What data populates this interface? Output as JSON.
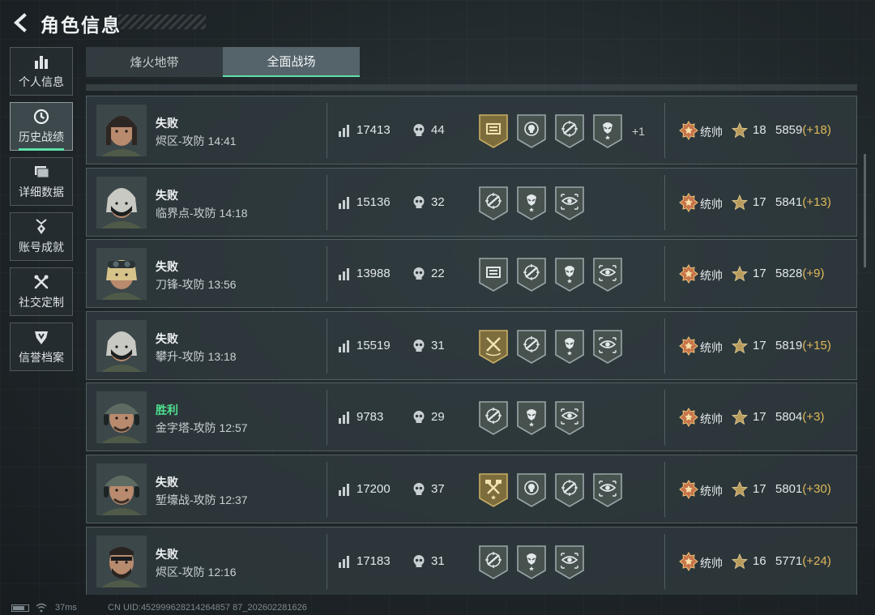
{
  "header": {
    "title": "角色信息"
  },
  "sidebar": {
    "items": [
      {
        "label": "个人信息",
        "icon": "bar-chart-icon",
        "active": false
      },
      {
        "label": "历史战绩",
        "icon": "clock-icon",
        "active": true
      },
      {
        "label": "详细数据",
        "icon": "folder-icon",
        "active": false
      },
      {
        "label": "账号成就",
        "icon": "medal-icon",
        "active": false
      },
      {
        "label": "社交定制",
        "icon": "tools-icon",
        "active": false
      },
      {
        "label": "信誉档案",
        "icon": "shield-icon",
        "active": false
      }
    ]
  },
  "tabs": [
    {
      "label": "烽火地带",
      "active": false
    },
    {
      "label": "全面战场",
      "active": true
    }
  ],
  "colors": {
    "accent": "#5fe0a8",
    "win": "#4ee08e",
    "delta": "#e0b85a",
    "gold_badge": "#8a7a45",
    "silver_badge": "#4a5558"
  },
  "matches": [
    {
      "result": "失败",
      "win": false,
      "map_time": "烬区-攻防 14:41",
      "score": "17413",
      "kills": "44",
      "badges": [
        "gold-screen-badge",
        "skull-badge",
        "crosshair-rifle-badge",
        "soldier-badge"
      ],
      "more": "+1",
      "rank_name": "统帅",
      "star_level": "18",
      "rank_points": "5859",
      "rank_delta": "(+18)",
      "avatar": "female-soldier-avatar"
    },
    {
      "result": "失败",
      "win": false,
      "map_time": "临界点-攻防 14:18",
      "score": "15136",
      "kills": "32",
      "badges": [
        "crosshair-rifle-badge",
        "soldier-badge",
        "eye-target-badge"
      ],
      "more": "",
      "rank_name": "统帅",
      "star_level": "17",
      "rank_points": "5841",
      "rank_delta": "(+13)",
      "avatar": "masked-soldier-avatar"
    },
    {
      "result": "失败",
      "win": false,
      "map_time": "刀锋-攻防 13:56",
      "score": "13988",
      "kills": "22",
      "badges": [
        "screen-badge",
        "crosshair-rifle-badge",
        "soldier-badge",
        "eye-target-badge"
      ],
      "more": "",
      "rank_name": "统帅",
      "star_level": "17",
      "rank_points": "5828",
      "rank_delta": "(+9)",
      "avatar": "goggles-soldier-avatar"
    },
    {
      "result": "失败",
      "win": false,
      "map_time": "攀升-攻防 13:18",
      "score": "15519",
      "kills": "31",
      "badges": [
        "gold-tools-badge",
        "crosshair-rifle-badge",
        "soldier-badge",
        "eye-target-badge"
      ],
      "more": "",
      "rank_name": "统帅",
      "star_level": "17",
      "rank_points": "5819",
      "rank_delta": "(+15)",
      "avatar": "masked-soldier-avatar"
    },
    {
      "result": "胜利",
      "win": true,
      "map_time": "金字塔-攻防 12:57",
      "score": "9783",
      "kills": "29",
      "badges": [
        "crosshair-rifle-badge",
        "soldier-badge",
        "eye-target-badge"
      ],
      "more": "",
      "rank_name": "统帅",
      "star_level": "17",
      "rank_points": "5804",
      "rank_delta": "(+3)",
      "avatar": "cap-headset-soldier-avatar"
    },
    {
      "result": "失败",
      "win": false,
      "map_time": "堑壕战-攻防 12:37",
      "score": "17200",
      "kills": "37",
      "badges": [
        "gold-hammer-badge",
        "skull-badge",
        "crosshair-rifle-badge",
        "eye-target-badge"
      ],
      "more": "",
      "rank_name": "统帅",
      "star_level": "17",
      "rank_points": "5801",
      "rank_delta": "(+30)",
      "avatar": "cap-headset-soldier-avatar"
    },
    {
      "result": "失败",
      "win": false,
      "map_time": "烬区-攻防 12:16",
      "score": "17183",
      "kills": "31",
      "badges": [
        "crosshair-rifle-badge",
        "soldier-badge",
        "eye-target-badge"
      ],
      "more": "",
      "rank_name": "统帅",
      "star_level": "16",
      "rank_points": "5771",
      "rank_delta": "(+24)",
      "avatar": "bearded-soldier-avatar"
    }
  ],
  "status": {
    "ping": "37ms",
    "uid": "CN UID:452999628214264857 87_202602281626"
  }
}
